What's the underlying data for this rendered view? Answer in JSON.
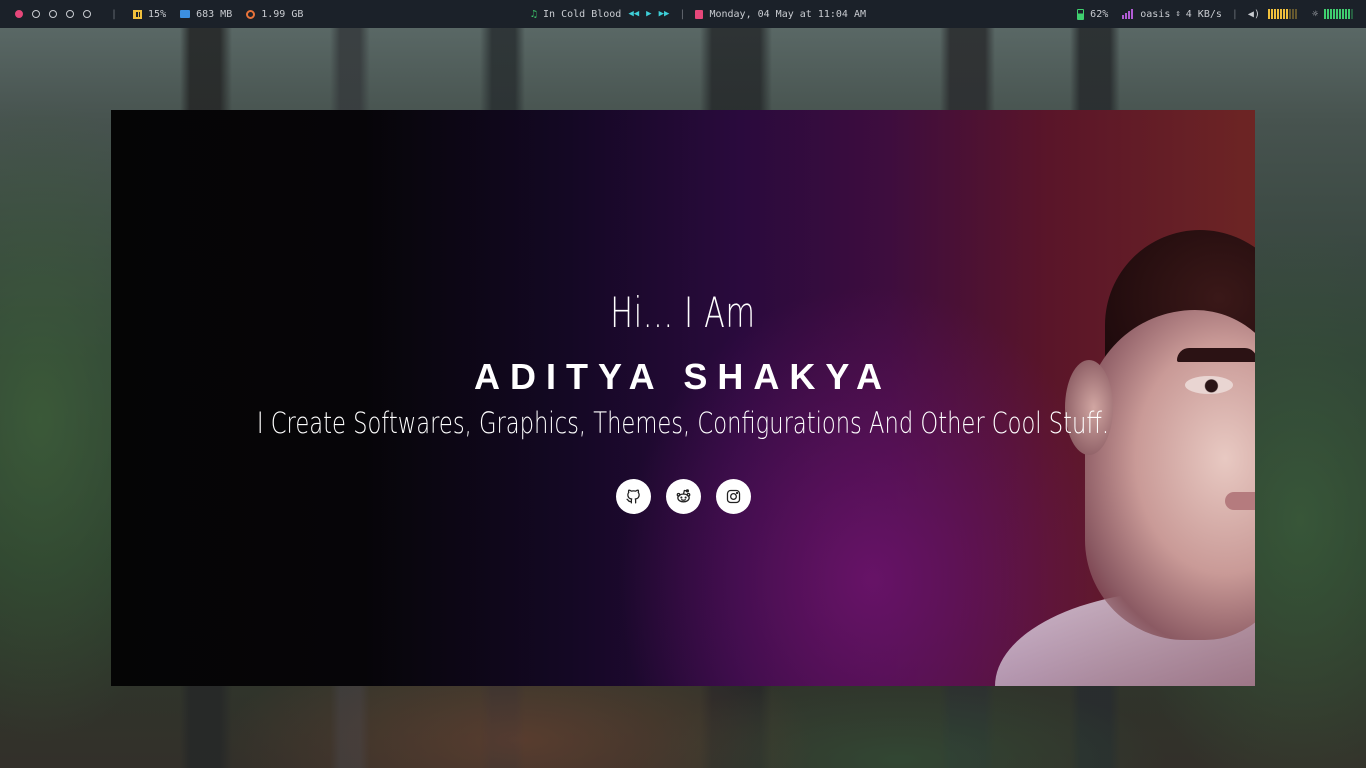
{
  "topbar": {
    "workspaces": [
      {
        "name": "ws-1",
        "active": true
      },
      {
        "name": "ws-2",
        "active": false
      },
      {
        "name": "ws-3",
        "active": false
      },
      {
        "name": "ws-4",
        "active": false
      },
      {
        "name": "ws-5",
        "active": false
      }
    ],
    "separator": "|",
    "cpu": "15%",
    "memory": "683 MB",
    "disk": "1.99 GB",
    "music_title": "In Cold Blood",
    "media_prev": "◀◀",
    "media_play": "▶",
    "media_next": "▶▶",
    "date": "Monday, 04 May at 11:04 AM",
    "battery": "62%",
    "network_name": "oasis",
    "network_arrows": "⇕",
    "network_speed": "4 KB/s",
    "volume_icon": "◀)",
    "brightness_icon": "☼",
    "volume_level": 0.6,
    "brightness_level": 0.8,
    "colors": {
      "accent_pink": "#e5477a",
      "cpu": "#f0c03c",
      "memory": "#3c8fe0",
      "disk": "#e8733a",
      "music": "#3fcf6f",
      "media": "#3ecfd8",
      "wifi": "#b25cd6"
    }
  },
  "hero": {
    "greeting": "Hi... I Am",
    "name": "ADITYA SHAKYA",
    "tagline": "I Create Softwares, Graphics, Themes, Configurations And Other Cool Stuff.",
    "socials": [
      {
        "icon": "github-icon"
      },
      {
        "icon": "reddit-icon"
      },
      {
        "icon": "instagram-icon"
      }
    ]
  }
}
